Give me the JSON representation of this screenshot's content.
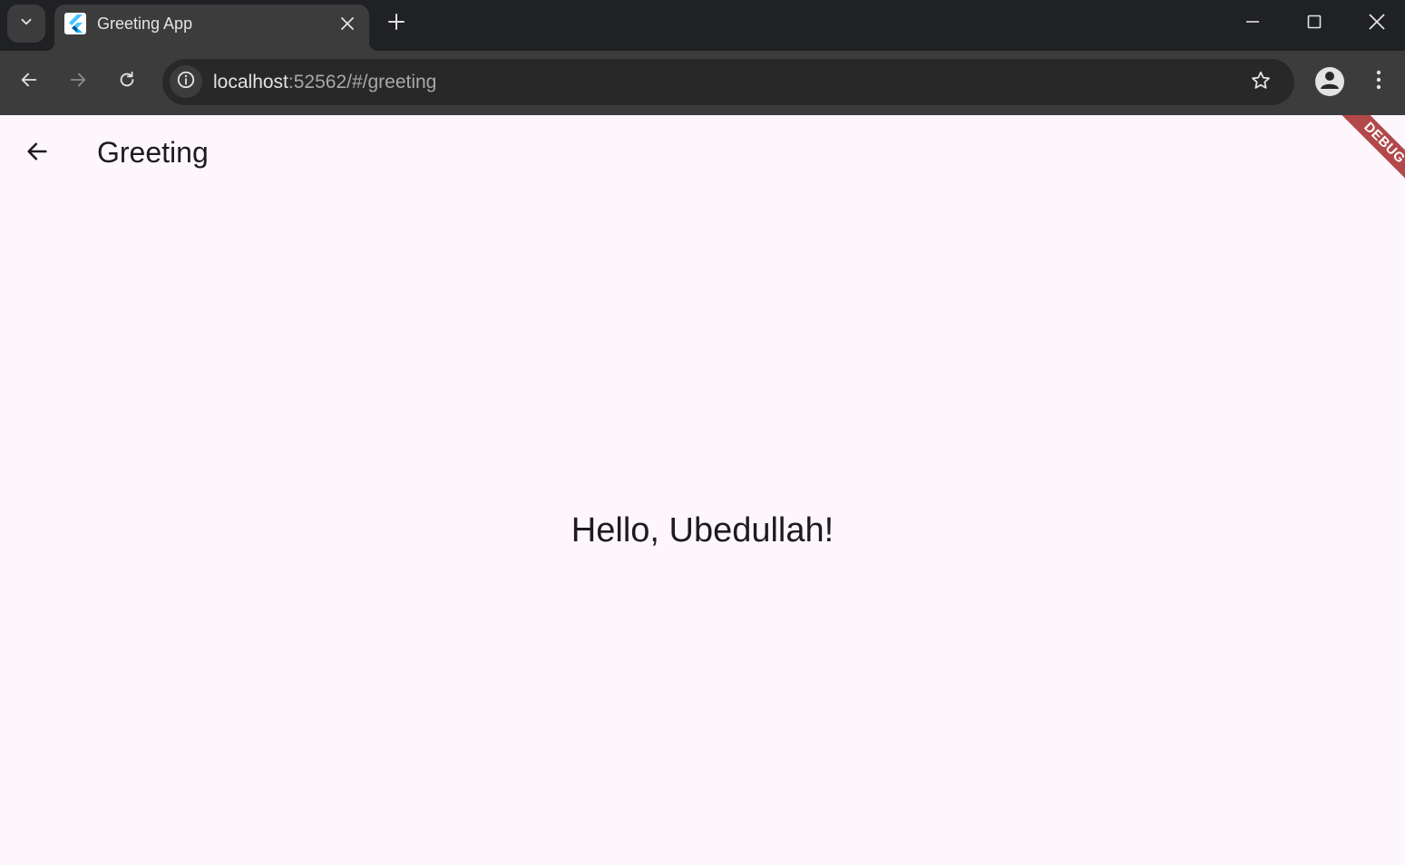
{
  "browser": {
    "tab": {
      "title": "Greeting App",
      "favicon_icon": "flutter-logo-icon"
    },
    "toolbar": {
      "url_host": "localhost",
      "url_rest": ":52562/#/greeting"
    },
    "window_controls": [
      "minimize-icon",
      "maximize-icon",
      "close-icon"
    ]
  },
  "app": {
    "appbar": {
      "title": "Greeting",
      "back_icon": "arrow-back-icon"
    },
    "body": {
      "greeting_text": "Hello, Ubedullah!"
    },
    "debug_banner": "DEBUG"
  },
  "colors": {
    "page_background": "#fdf7fd",
    "text": "#1d1b20",
    "debug_banner": "#a52a2a",
    "browser_chrome": "#3c3c3c",
    "tabstrip": "#202124"
  }
}
